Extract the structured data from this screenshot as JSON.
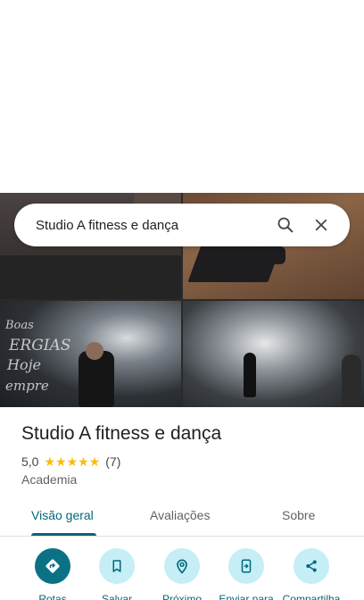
{
  "search": {
    "query": "Studio A fitness e dança"
  },
  "place": {
    "name": "Studio A fitness e dança",
    "rating": "5,0",
    "review_count": "(7)",
    "stars": 5,
    "category": "Academia"
  },
  "photos": {
    "chalkboard_text": [
      "Boas",
      "ERGIAS",
      "Hoje",
      "empre"
    ]
  },
  "tabs": [
    {
      "label": "Visão geral",
      "active": true
    },
    {
      "label": "Avaliações",
      "active": false
    },
    {
      "label": "Sobre",
      "active": false
    }
  ],
  "actions": [
    {
      "label": "Rotas",
      "icon": "directions-icon"
    },
    {
      "label": "Salvar",
      "icon": "bookmark-icon"
    },
    {
      "label": "Próximo",
      "icon": "nearby-icon"
    },
    {
      "label": "Enviar para",
      "icon": "send-to-phone-icon"
    },
    {
      "label": "Compartilha",
      "icon": "share-icon"
    }
  ],
  "colors": {
    "accent": "#00687a",
    "star": "#fbbc04",
    "action_bg": "#c5eef7",
    "primary_action": "#0b7285"
  }
}
